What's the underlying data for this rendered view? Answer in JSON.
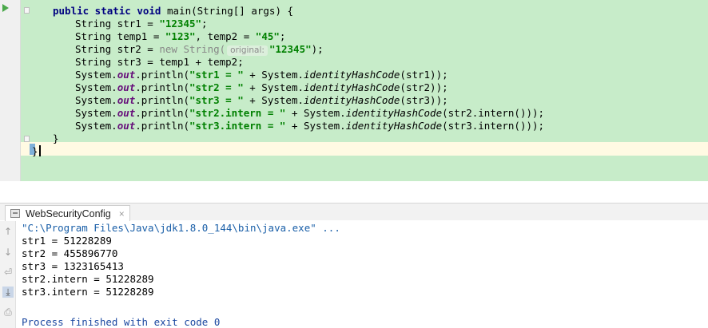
{
  "editor": {
    "signature": {
      "mods": "public static void",
      "name": " main(String[] args) {"
    },
    "line1": {
      "text": "String str1 = ",
      "value": "\"12345\"",
      "end": ";"
    },
    "line2": {
      "text1": "String temp1 = ",
      "value1": "\"123\"",
      "text2": ", temp2 = ",
      "value2": "\"45\"",
      "end": ";"
    },
    "line3": {
      "text1": "String str2 = ",
      "new_kw": "new",
      "cls": " String(",
      "hint": "original:",
      "value": "\"12345\"",
      "end": ");"
    },
    "line4": {
      "text": "String str3 = temp1 + temp2;"
    },
    "prints": [
      {
        "obj": "System.",
        "field": "out",
        "call": ".println(",
        "label": "\"str1 = \"",
        "mid": " + System.",
        "method": "identityHashCode",
        "arg": "(str1));"
      },
      {
        "obj": "System.",
        "field": "out",
        "call": ".println(",
        "label": "\"str2 = \"",
        "mid": " + System.",
        "method": "identityHashCode",
        "arg": "(str2));"
      },
      {
        "obj": "System.",
        "field": "out",
        "call": ".println(",
        "label": "\"str3 = \"",
        "mid": " + System.",
        "method": "identityHashCode",
        "arg": "(str3));"
      },
      {
        "obj": "System.",
        "field": "out",
        "call": ".println(",
        "label": "\"str2.intern = \"",
        "mid": " + System.",
        "method": "identityHashCode",
        "arg": "(str2.intern()));"
      },
      {
        "obj": "System.",
        "field": "out",
        "call": ".println(",
        "label": "\"str3.intern = \"",
        "mid": " + System.",
        "method": "identityHashCode",
        "arg": "(str3.intern()));"
      }
    ],
    "close_method": "}",
    "close_class": "}"
  },
  "run_panel": {
    "tab_label": "WebSecurityConfig",
    "tab_close": "×",
    "tool_icons": [
      "arrow-up-icon",
      "arrow-down-icon",
      "soft-wrap-icon",
      "scroll-to-end-icon",
      "print-icon"
    ],
    "command": "\"C:\\Program Files\\Java\\jdk1.8.0_144\\bin\\java.exe\" ...",
    "output": [
      "str1 = 51228289",
      "str2 = 455896770",
      "str3 = 1323165413",
      "str2.intern = 51228289",
      "str3.intern = 51228289"
    ],
    "exit_message": "Process finished with exit code 0"
  }
}
